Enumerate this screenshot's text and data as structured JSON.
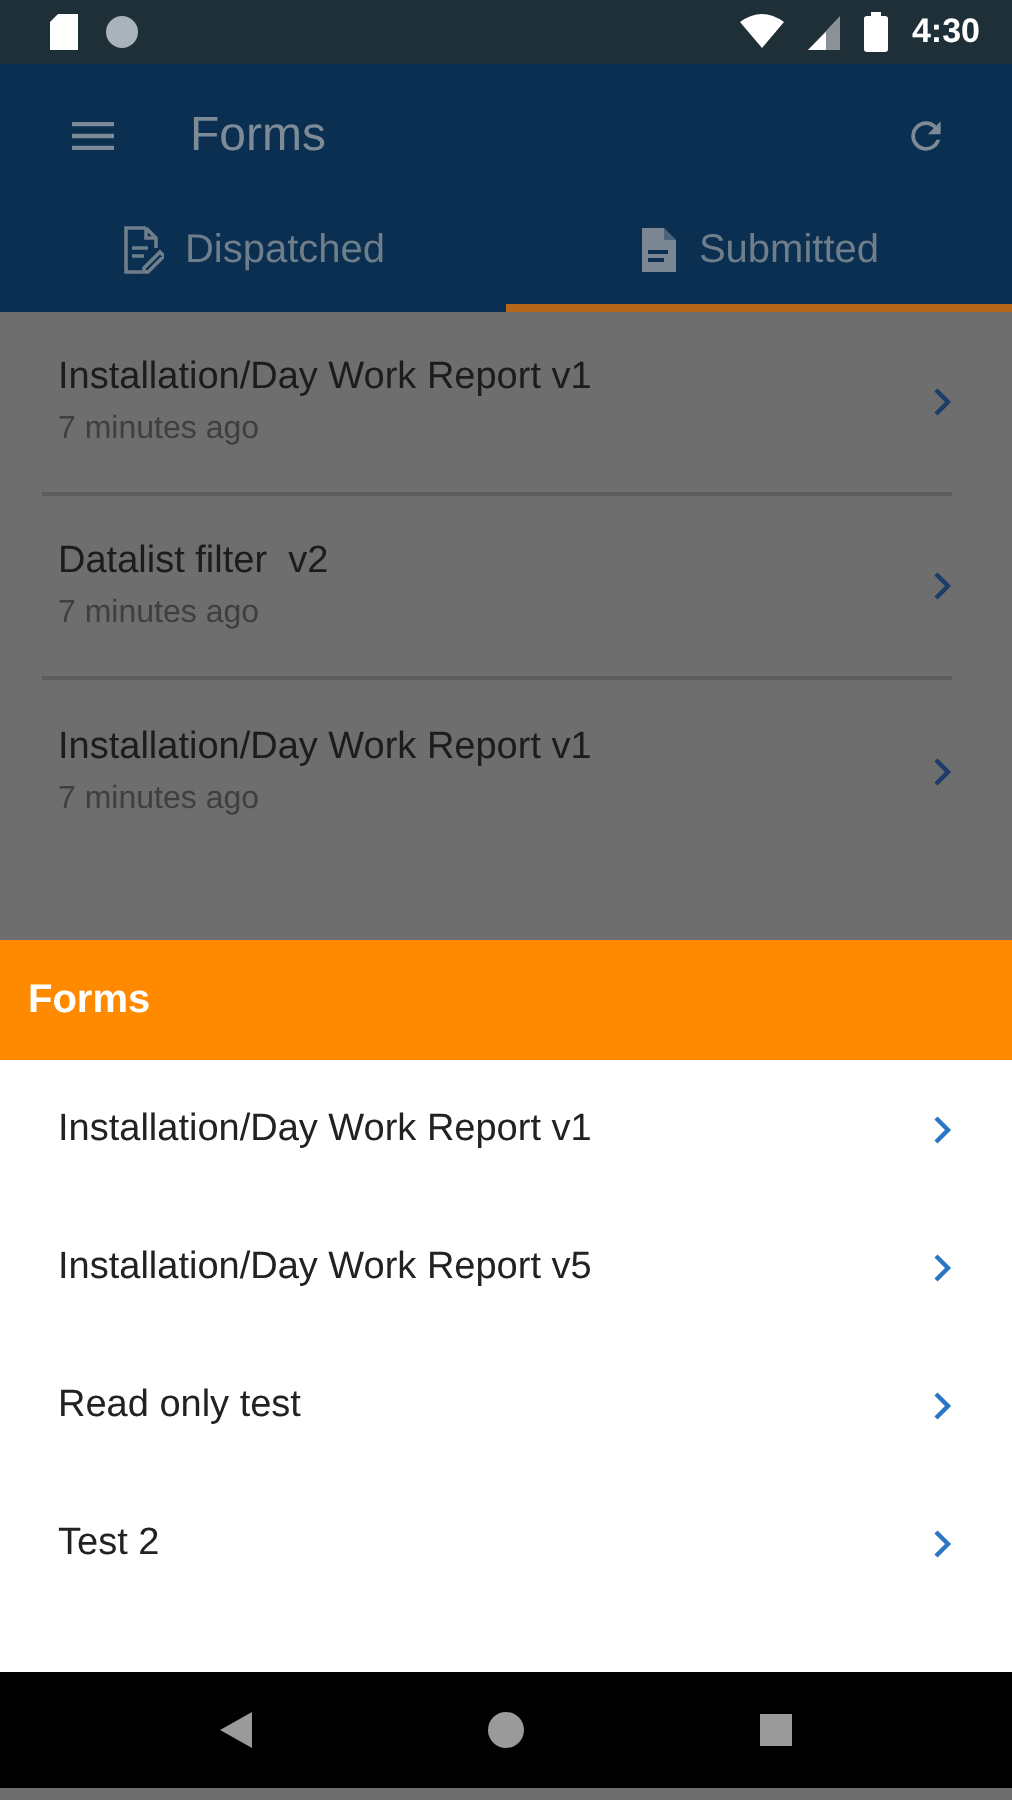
{
  "status_bar": {
    "time": "4:30"
  },
  "app_bar": {
    "title": "Forms"
  },
  "tabs": [
    {
      "label": "Dispatched",
      "selected": false,
      "kind": "edit"
    },
    {
      "label": "Submitted",
      "selected": true,
      "kind": "doc"
    }
  ],
  "submitted": [
    {
      "title": "Installation/Day Work Report v1",
      "time": "7 minutes ago"
    },
    {
      "title": "Datalist filter  v2",
      "time": "7 minutes ago"
    },
    {
      "title": "Installation/Day Work Report v1",
      "time": "7 minutes ago"
    }
  ],
  "sheet": {
    "title": "Forms",
    "items": [
      {
        "title": "Installation/Day Work Report v1"
      },
      {
        "title": "Installation/Day Work Report v5"
      },
      {
        "title": "Read only test"
      },
      {
        "title": "Test 2"
      }
    ]
  }
}
